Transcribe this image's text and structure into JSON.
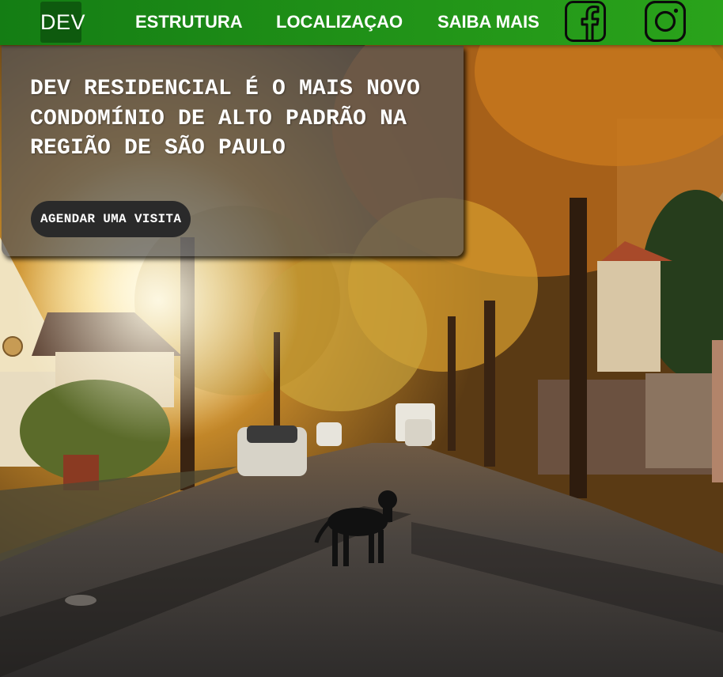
{
  "header": {
    "logo_text": "DEV",
    "nav": [
      {
        "label": "ESTRUTURA"
      },
      {
        "label": "LOCALIZAÇAO"
      },
      {
        "label": "SAIBA MAIS"
      }
    ],
    "social": [
      {
        "icon": "facebook-icon"
      },
      {
        "icon": "instagram-icon"
      }
    ]
  },
  "intro": {
    "headline": "DEV RESIDENCIAL É O MAIS NOVO CONDOMÍNIO DE ALTO PADRÃO NA REGIÃO DE SÃO PAULO",
    "cta_label": "AGENDAR UMA VISITA"
  },
  "colors": {
    "header_green": "#1f8f17",
    "logo_green": "#0e5a0e",
    "icon_outline": "#0b0b0b",
    "cta_bg": "#2a2a2a"
  }
}
